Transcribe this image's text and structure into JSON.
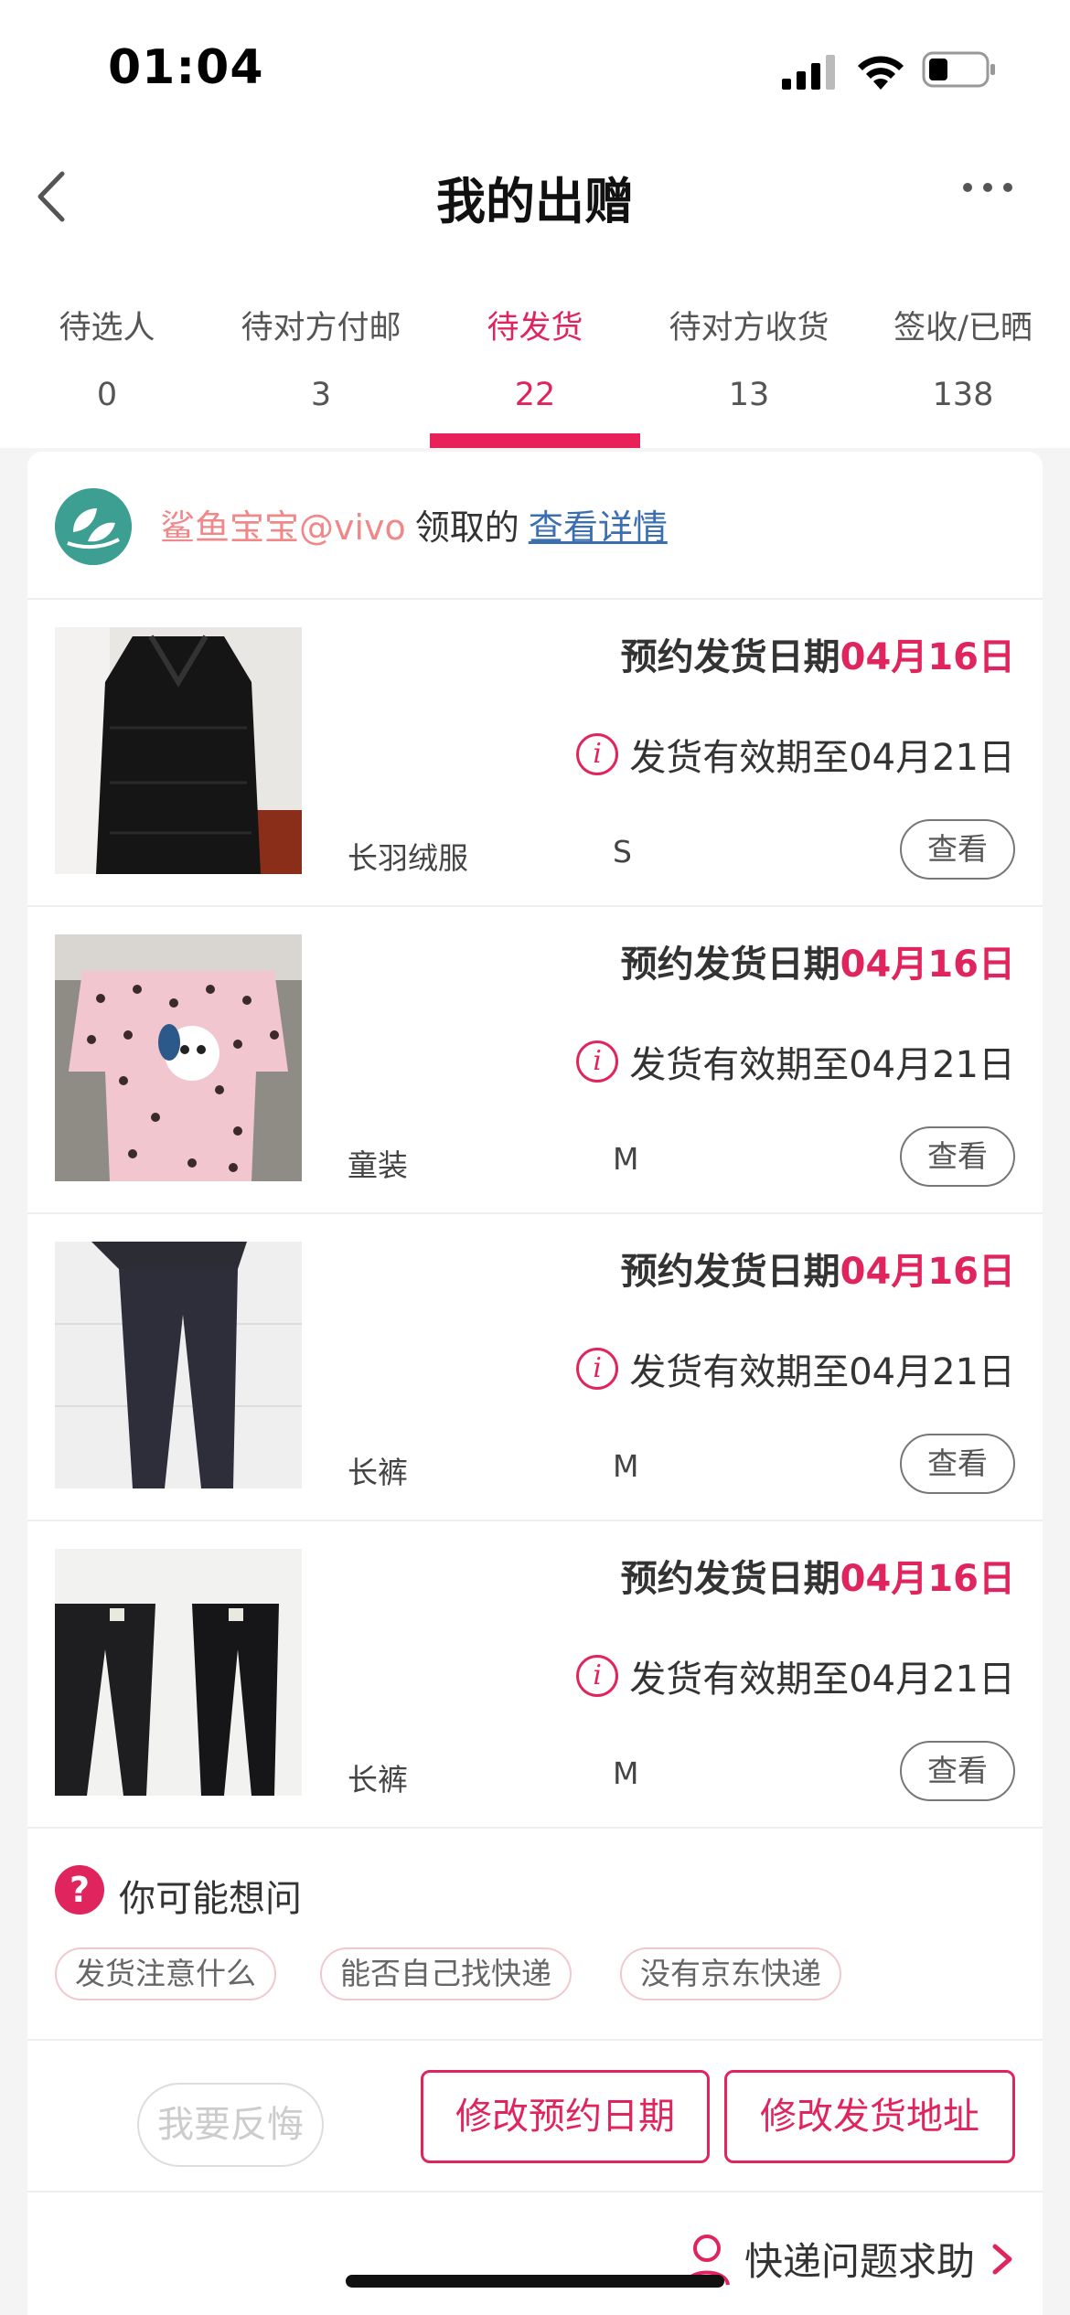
{
  "status_bar": {
    "time": "01:04"
  },
  "nav": {
    "title": "我的出赠"
  },
  "tabs": [
    {
      "label": "待选人",
      "count": "0"
    },
    {
      "label": "待对方付邮",
      "count": "3"
    },
    {
      "label": "待发货",
      "count": "22",
      "active": true
    },
    {
      "label": "待对方收货",
      "count": "13"
    },
    {
      "label": "签收/已晒",
      "count": "138"
    }
  ],
  "owner": {
    "name": "鲨鱼宝宝@vivo",
    "suffix": "领取的",
    "link": "查看详情"
  },
  "items": [
    {
      "date_label": "预约发货日期",
      "date_value": "04月16日",
      "expiry": "发货有效期至04月21日",
      "name": "长羽绒服",
      "size": "S",
      "view": "查看",
      "image": "black-down-coat"
    },
    {
      "date_label": "预约发货日期",
      "date_value": "04月16日",
      "expiry": "发货有效期至04月21日",
      "name": "童装",
      "size": "M",
      "view": "查看",
      "image": "pink-polka-dot-kids-outfit"
    },
    {
      "date_label": "预约发货日期",
      "date_value": "04月16日",
      "expiry": "发货有效期至04月21日",
      "name": "长裤",
      "size": "M",
      "view": "查看",
      "image": "dark-leggings"
    },
    {
      "date_label": "预约发货日期",
      "date_value": "04月16日",
      "expiry": "发货有效期至04月21日",
      "name": "长裤",
      "size": "M",
      "view": "查看",
      "image": "two-black-leggings"
    }
  ],
  "faq": {
    "title": "你可能想问",
    "chips": [
      "发货注意什么",
      "能否自己找快递",
      "没有京东快递"
    ]
  },
  "actions": {
    "regret": "我要反悔",
    "change_date": "修改预约日期",
    "change_address": "修改发货地址"
  },
  "help": {
    "label": "快递问题求助"
  },
  "colors": {
    "accent": "#e0245e",
    "owner_name": "#f0888a",
    "link": "#3c6fb0"
  }
}
